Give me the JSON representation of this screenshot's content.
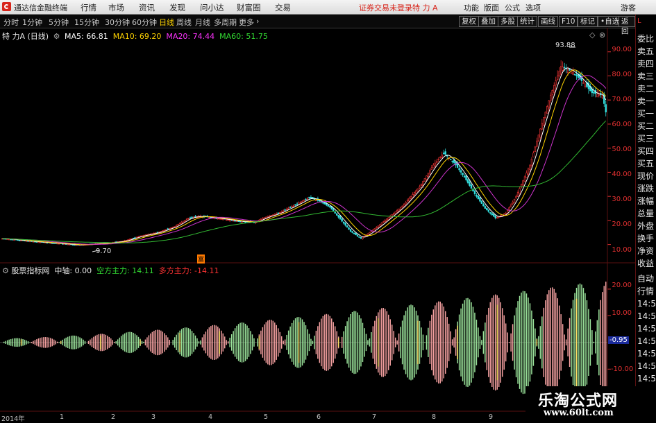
{
  "menubar": {
    "app_title": "通达信金融终端",
    "items": [
      "行情",
      "市场",
      "资讯",
      "发现",
      "问小达",
      "财富圈",
      "交易"
    ],
    "account_status": "证券交易未登录",
    "stock_name": "特 力 A",
    "right_items": [
      "功能",
      "版面",
      "公式",
      "选项"
    ],
    "user": "游客"
  },
  "periodbar": {
    "periods": [
      "分时",
      "1分钟",
      "5分钟",
      "15分钟",
      "30分钟",
      "60分钟",
      "日线",
      "周线",
      "月线",
      "多周期",
      "更多"
    ],
    "active_period": "日线",
    "tools": [
      "复权",
      "叠加",
      "多股",
      "统计",
      "画线",
      "F10",
      "标记"
    ],
    "more_select": "•自选",
    "back": "返回"
  },
  "main_info": {
    "title": "特 力A (日线)",
    "ma": [
      {
        "label": "MA5: 66.81",
        "color": "#ffffff"
      },
      {
        "label": "MA10: 69.20",
        "color": "#ffd400"
      },
      {
        "label": "MA20: 74.44",
        "color": "#ff33ff"
      },
      {
        "label": "MA60: 51.75",
        "color": "#33dd33"
      }
    ],
    "high_label": "93.88",
    "low_label": "9.70",
    "event_marker": "富"
  },
  "sub_info": {
    "title": "股票指标网",
    "zhongzhou": "中轴: 0.00",
    "kong_label": "空方主力: 14.11",
    "duo_label": "多方主力: -14.11",
    "current_value": "-0.95"
  },
  "axes": {
    "main_y": [
      "90.00",
      "80.00",
      "70.00",
      "60.00",
      "50.00",
      "40.00",
      "30.00",
      "20.00",
      "10.00"
    ],
    "sub_y": [
      "20.00",
      "10.00",
      "-10.00"
    ],
    "x": [
      "2014年",
      "1",
      "2",
      "3",
      "4",
      "5",
      "6",
      "7",
      "8",
      "9"
    ]
  },
  "right_panel": {
    "items": [
      "委比",
      "卖五",
      "卖四",
      "卖三",
      "卖二",
      "卖一",
      "买一",
      "买二",
      "买三",
      "买四",
      "买五",
      "现价",
      "涨跌",
      "涨幅",
      "总量",
      "外盘",
      "换手",
      "净资",
      "收益"
    ],
    "bottom": [
      "自动",
      "行情",
      "14:5",
      "14:5",
      "14:5",
      "14:5",
      "14:5",
      "14:5",
      "14:5"
    ]
  },
  "watermark": {
    "line1": "乐淘公式网",
    "line2": "www.60lt.com"
  },
  "colors": {
    "up": "#e03030",
    "down": "#33dddd",
    "ma5": "#ffffff",
    "ma10": "#ffd400",
    "ma20": "#cc33cc",
    "ma60": "#33bb33",
    "bull": "#9be39b",
    "bear": "#f4a0a0"
  },
  "chart_data": {
    "type": "candlestick",
    "price_ylim": [
      5,
      100
    ],
    "sub_ylim": [
      -25,
      27
    ],
    "months": [
      "2014年",
      "1",
      "2",
      "3",
      "4",
      "5",
      "6",
      "7",
      "8",
      "9"
    ],
    "keypoints": [
      [
        0,
        12.5
      ],
      [
        10,
        11.8
      ],
      [
        22,
        11
      ],
      [
        34,
        10.4
      ],
      [
        44,
        9.8
      ],
      [
        54,
        10.3
      ],
      [
        62,
        10.7
      ],
      [
        70,
        11.4
      ],
      [
        80,
        13.5
      ],
      [
        90,
        15
      ],
      [
        100,
        17.5
      ],
      [
        108,
        21
      ],
      [
        114,
        21.8
      ],
      [
        122,
        21.2
      ],
      [
        130,
        20.4
      ],
      [
        138,
        19.6
      ],
      [
        146,
        19.2
      ],
      [
        152,
        21.2
      ],
      [
        160,
        23
      ],
      [
        170,
        26.5
      ],
      [
        178,
        29.5
      ],
      [
        184,
        28
      ],
      [
        190,
        25.5
      ],
      [
        196,
        20.5
      ],
      [
        202,
        15.5
      ],
      [
        208,
        12.5
      ],
      [
        214,
        15.5
      ],
      [
        222,
        20
      ],
      [
        232,
        26
      ],
      [
        242,
        34
      ],
      [
        250,
        43
      ],
      [
        256,
        48
      ],
      [
        262,
        44
      ],
      [
        268,
        38
      ],
      [
        274,
        31
      ],
      [
        280,
        25
      ],
      [
        286,
        21
      ],
      [
        292,
        23
      ],
      [
        298,
        30
      ],
      [
        306,
        43
      ],
      [
        312,
        58
      ],
      [
        318,
        72
      ],
      [
        324,
        84
      ],
      [
        330,
        82
      ],
      [
        336,
        78
      ],
      [
        342,
        73
      ],
      [
        348,
        72
      ],
      [
        350,
        65
      ]
    ]
  }
}
